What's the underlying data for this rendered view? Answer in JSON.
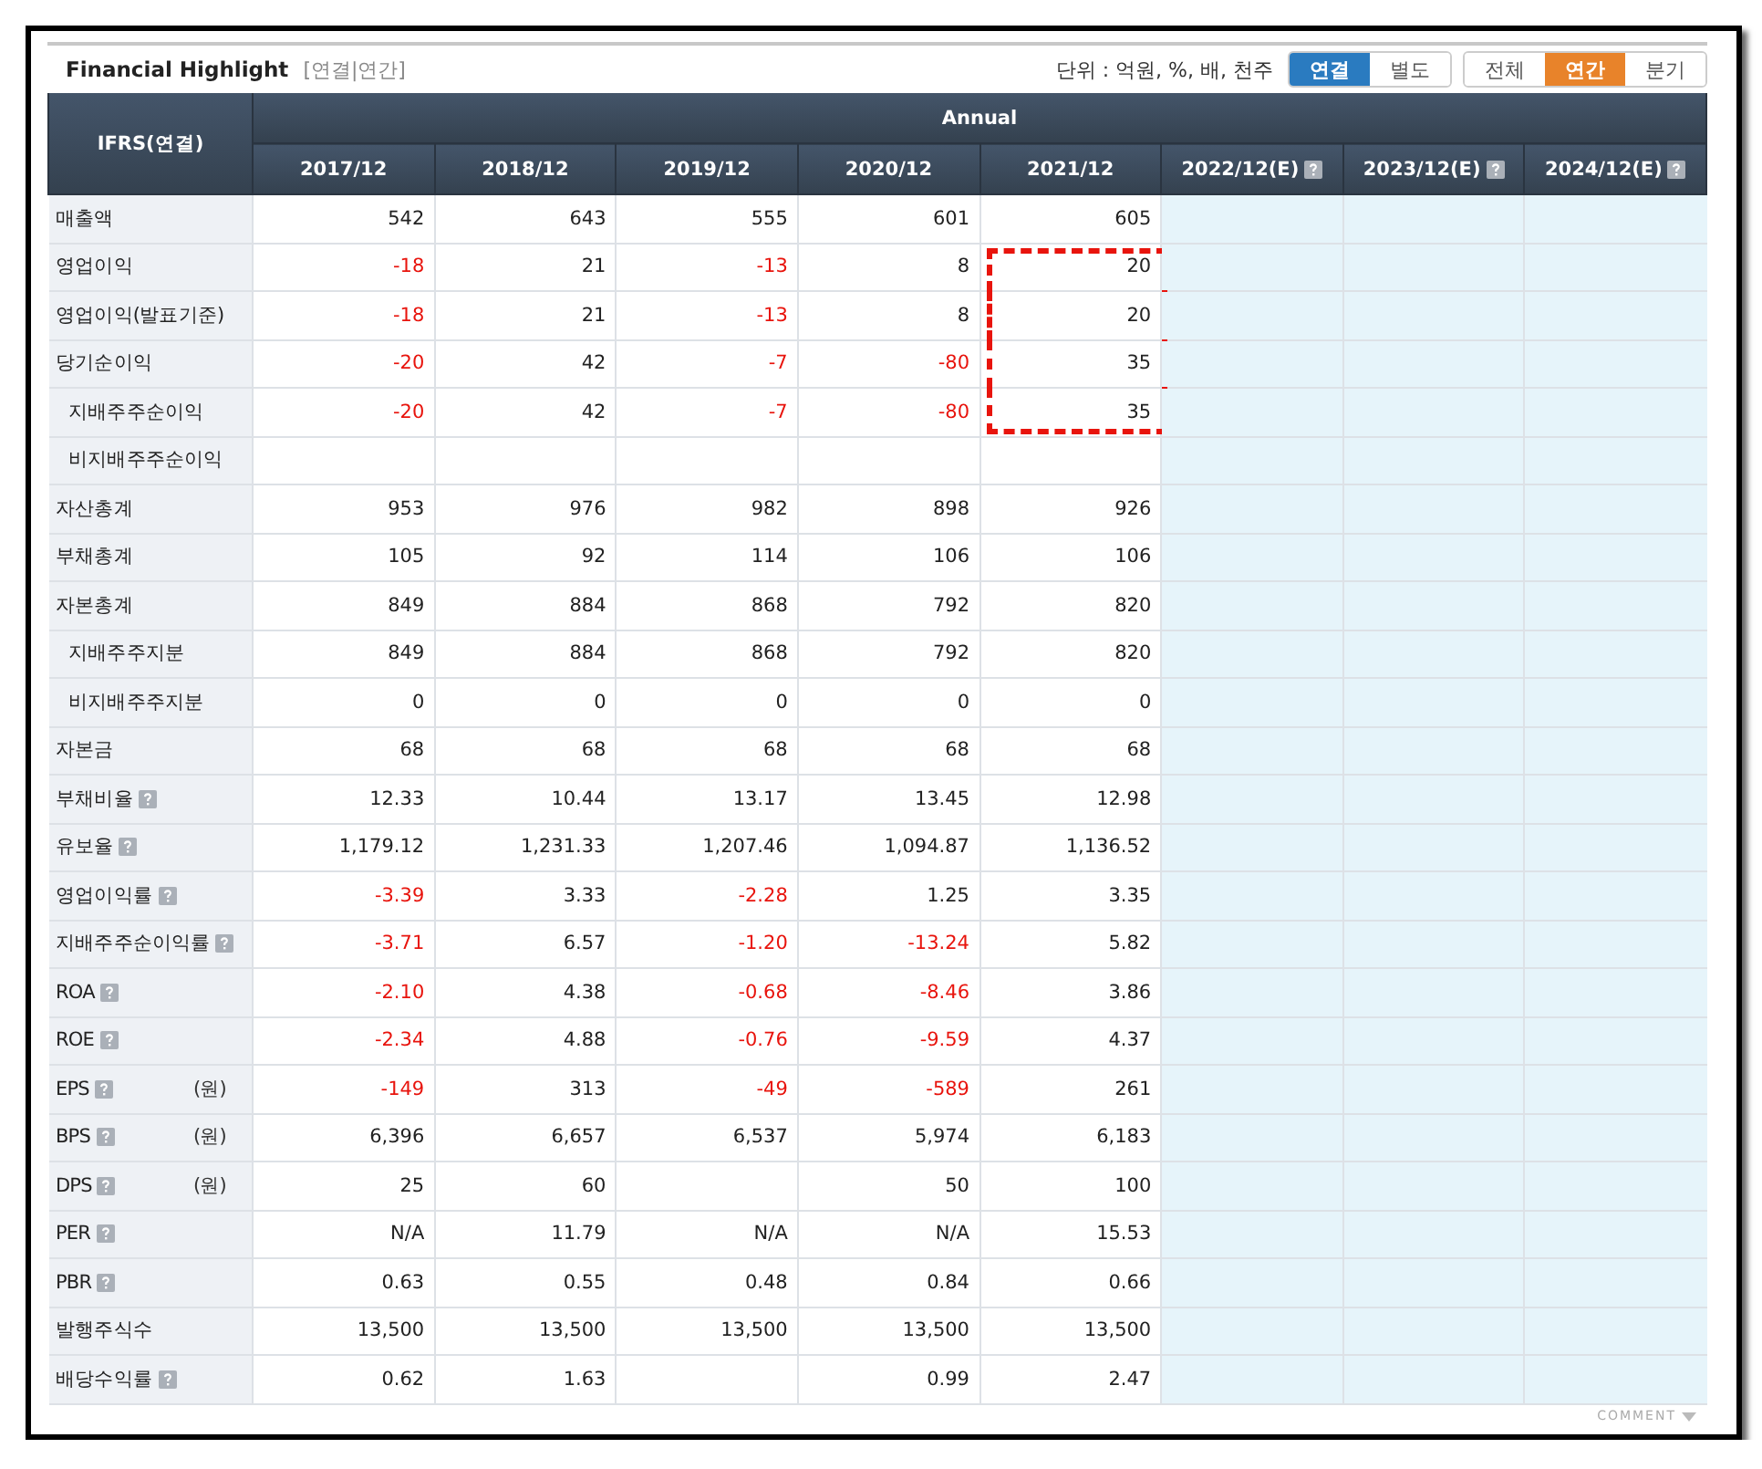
{
  "title": "Financial Highlight",
  "subtitle": "[연결|연간]",
  "unit": "단위 : 억원, %, 배, 천주",
  "toggle_groups": [
    {
      "kind": "consolidation",
      "options": [
        {
          "label": "연결",
          "selected": true
        },
        {
          "label": "별도",
          "selected": false
        }
      ]
    },
    {
      "kind": "period",
      "options": [
        {
          "label": "전체",
          "selected": false
        },
        {
          "label": "연간",
          "selected": true
        },
        {
          "label": "분기",
          "selected": false
        }
      ]
    }
  ],
  "table": {
    "corner": "IFRS(연결)",
    "group": "Annual",
    "columns": [
      {
        "label": "2017/12",
        "estimate": false
      },
      {
        "label": "2018/12",
        "estimate": false
      },
      {
        "label": "2019/12",
        "estimate": false
      },
      {
        "label": "2020/12",
        "estimate": false
      },
      {
        "label": "2021/12",
        "estimate": false
      },
      {
        "label": "2022/12(E)",
        "estimate": true
      },
      {
        "label": "2023/12(E)",
        "estimate": true
      },
      {
        "label": "2024/12(E)",
        "estimate": true
      }
    ],
    "rows": [
      {
        "label": "매출액",
        "indent": false,
        "help": false,
        "cells": [
          {
            "value": "542",
            "negative": false,
            "boxed": false
          },
          {
            "value": "643",
            "negative": false,
            "boxed": false
          },
          {
            "value": "555",
            "negative": false,
            "boxed": false
          },
          {
            "value": "601",
            "negative": false,
            "boxed": false
          },
          {
            "value": "605",
            "negative": false,
            "boxed": false
          }
        ]
      },
      {
        "label": "영업이익",
        "indent": false,
        "help": false,
        "cells": [
          {
            "value": "-18",
            "negative": true,
            "boxed": false
          },
          {
            "value": "21",
            "negative": false,
            "boxed": false
          },
          {
            "value": "-13",
            "negative": true,
            "boxed": false
          },
          {
            "value": "8",
            "negative": false,
            "boxed": false
          },
          {
            "value": "20",
            "negative": false,
            "boxed": true
          }
        ]
      },
      {
        "label": "영업이익(발표기준)",
        "indent": false,
        "help": false,
        "cells": [
          {
            "value": "-18",
            "negative": true,
            "boxed": false
          },
          {
            "value": "21",
            "negative": false,
            "boxed": false
          },
          {
            "value": "-13",
            "negative": true,
            "boxed": false
          },
          {
            "value": "8",
            "negative": false,
            "boxed": false
          },
          {
            "value": "20",
            "negative": false,
            "boxed": true
          }
        ]
      },
      {
        "label": "당기순이익",
        "indent": false,
        "help": false,
        "cells": [
          {
            "value": "-20",
            "negative": true,
            "boxed": false
          },
          {
            "value": "42",
            "negative": false,
            "boxed": false
          },
          {
            "value": "-7",
            "negative": true,
            "boxed": false
          },
          {
            "value": "-80",
            "negative": true,
            "boxed": false
          },
          {
            "value": "35",
            "negative": false,
            "boxed": true
          }
        ]
      },
      {
        "label": "지배주주순이익",
        "indent": true,
        "help": false,
        "cells": [
          {
            "value": "-20",
            "negative": true,
            "boxed": false
          },
          {
            "value": "42",
            "negative": false,
            "boxed": false
          },
          {
            "value": "-7",
            "negative": true,
            "boxed": false
          },
          {
            "value": "-80",
            "negative": true,
            "boxed": false
          },
          {
            "value": "35",
            "negative": false,
            "boxed": true
          }
        ]
      },
      {
        "label": "비지배주주순이익",
        "indent": true,
        "help": false,
        "cells": [
          {
            "negative": false,
            "boxed": false
          },
          {
            "negative": false,
            "boxed": false
          },
          {
            "negative": false,
            "boxed": false
          },
          {
            "negative": false,
            "boxed": false
          },
          {
            "negative": false,
            "boxed": false
          }
        ]
      },
      {
        "label": "자산총계",
        "indent": false,
        "help": false,
        "cells": [
          {
            "value": "953",
            "negative": false,
            "boxed": false
          },
          {
            "value": "976",
            "negative": false,
            "boxed": false
          },
          {
            "value": "982",
            "negative": false,
            "boxed": false
          },
          {
            "value": "898",
            "negative": false,
            "boxed": false
          },
          {
            "value": "926",
            "negative": false,
            "boxed": false
          }
        ]
      },
      {
        "label": "부채총계",
        "indent": false,
        "help": false,
        "cells": [
          {
            "value": "105",
            "negative": false,
            "boxed": false
          },
          {
            "value": "92",
            "negative": false,
            "boxed": false
          },
          {
            "value": "114",
            "negative": false,
            "boxed": false
          },
          {
            "value": "106",
            "negative": false,
            "boxed": false
          },
          {
            "value": "106",
            "negative": false,
            "boxed": false
          }
        ]
      },
      {
        "label": "자본총계",
        "indent": false,
        "help": false,
        "cells": [
          {
            "value": "849",
            "negative": false,
            "boxed": false
          },
          {
            "value": "884",
            "negative": false,
            "boxed": false
          },
          {
            "value": "868",
            "negative": false,
            "boxed": false
          },
          {
            "value": "792",
            "negative": false,
            "boxed": false
          },
          {
            "value": "820",
            "negative": false,
            "boxed": false
          }
        ]
      },
      {
        "label": "지배주주지분",
        "indent": true,
        "help": false,
        "cells": [
          {
            "value": "849",
            "negative": false,
            "boxed": false
          },
          {
            "value": "884",
            "negative": false,
            "boxed": false
          },
          {
            "value": "868",
            "negative": false,
            "boxed": false
          },
          {
            "value": "792",
            "negative": false,
            "boxed": false
          },
          {
            "value": "820",
            "negative": false,
            "boxed": false
          }
        ]
      },
      {
        "label": "비지배주주지분",
        "indent": true,
        "help": false,
        "cells": [
          {
            "value": "0",
            "negative": false,
            "boxed": false
          },
          {
            "value": "0",
            "negative": false,
            "boxed": false
          },
          {
            "value": "0",
            "negative": false,
            "boxed": false
          },
          {
            "value": "0",
            "negative": false,
            "boxed": false
          },
          {
            "value": "0",
            "negative": false,
            "boxed": false
          }
        ]
      },
      {
        "label": "자본금",
        "indent": false,
        "help": false,
        "cells": [
          {
            "value": "68",
            "negative": false,
            "boxed": false
          },
          {
            "value": "68",
            "negative": false,
            "boxed": false
          },
          {
            "value": "68",
            "negative": false,
            "boxed": false
          },
          {
            "value": "68",
            "negative": false,
            "boxed": false
          },
          {
            "value": "68",
            "negative": false,
            "boxed": false
          }
        ]
      },
      {
        "label": "부채비율",
        "indent": false,
        "help": true,
        "cells": [
          {
            "value": "12.33",
            "negative": false,
            "boxed": false
          },
          {
            "value": "10.44",
            "negative": false,
            "boxed": false
          },
          {
            "value": "13.17",
            "negative": false,
            "boxed": false
          },
          {
            "value": "13.45",
            "negative": false,
            "boxed": false
          },
          {
            "value": "12.98",
            "negative": false,
            "boxed": false
          }
        ]
      },
      {
        "label": "유보율",
        "indent": false,
        "help": true,
        "cells": [
          {
            "value": "1,179.12",
            "negative": false,
            "boxed": false
          },
          {
            "value": "1,231.33",
            "negative": false,
            "boxed": false
          },
          {
            "value": "1,207.46",
            "negative": false,
            "boxed": false
          },
          {
            "value": "1,094.87",
            "negative": false,
            "boxed": false
          },
          {
            "value": "1,136.52",
            "negative": false,
            "boxed": false
          }
        ]
      },
      {
        "label": "영업이익률",
        "indent": false,
        "help": true,
        "cells": [
          {
            "value": "-3.39",
            "negative": true,
            "boxed": false
          },
          {
            "value": "3.33",
            "negative": false,
            "boxed": false
          },
          {
            "value": "-2.28",
            "negative": true,
            "boxed": false
          },
          {
            "value": "1.25",
            "negative": false,
            "boxed": false
          },
          {
            "value": "3.35",
            "negative": false,
            "boxed": false
          }
        ]
      },
      {
        "label": "지배주주순이익률",
        "indent": false,
        "help": true,
        "cells": [
          {
            "value": "-3.71",
            "negative": true,
            "boxed": false
          },
          {
            "value": "6.57",
            "negative": false,
            "boxed": false
          },
          {
            "value": "-1.20",
            "negative": true,
            "boxed": false
          },
          {
            "value": "-13.24",
            "negative": true,
            "boxed": false
          },
          {
            "value": "5.82",
            "negative": false,
            "boxed": false
          }
        ]
      },
      {
        "label": "ROA",
        "indent": false,
        "help": true,
        "cells": [
          {
            "value": "-2.10",
            "negative": true,
            "boxed": false
          },
          {
            "value": "4.38",
            "negative": false,
            "boxed": false
          },
          {
            "value": "-0.68",
            "negative": true,
            "boxed": false
          },
          {
            "value": "-8.46",
            "negative": true,
            "boxed": false
          },
          {
            "value": "3.86",
            "negative": false,
            "boxed": false
          }
        ]
      },
      {
        "label": "ROE",
        "indent": false,
        "help": true,
        "cells": [
          {
            "value": "-2.34",
            "negative": true,
            "boxed": false
          },
          {
            "value": "4.88",
            "negative": false,
            "boxed": false
          },
          {
            "value": "-0.76",
            "negative": true,
            "boxed": false
          },
          {
            "value": "-9.59",
            "negative": true,
            "boxed": false
          },
          {
            "value": "4.37",
            "negative": false,
            "boxed": false
          }
        ]
      },
      {
        "label": "EPS",
        "indent": false,
        "help": true,
        "unit": "(원)",
        "cells": [
          {
            "value": "-149",
            "negative": true,
            "boxed": false
          },
          {
            "value": "313",
            "negative": false,
            "boxed": false
          },
          {
            "value": "-49",
            "negative": true,
            "boxed": false
          },
          {
            "value": "-589",
            "negative": true,
            "boxed": false
          },
          {
            "value": "261",
            "negative": false,
            "boxed": false
          }
        ]
      },
      {
        "label": "BPS",
        "indent": false,
        "help": true,
        "unit": "(원)",
        "cells": [
          {
            "value": "6,396",
            "negative": false,
            "boxed": false
          },
          {
            "value": "6,657",
            "negative": false,
            "boxed": false
          },
          {
            "value": "6,537",
            "negative": false,
            "boxed": false
          },
          {
            "value": "5,974",
            "negative": false,
            "boxed": false
          },
          {
            "value": "6,183",
            "negative": false,
            "boxed": false
          }
        ]
      },
      {
        "label": "DPS",
        "indent": false,
        "help": true,
        "unit": "(원)",
        "cells": [
          {
            "value": "25",
            "negative": false,
            "boxed": false
          },
          {
            "value": "60",
            "negative": false,
            "boxed": false
          },
          {
            "negative": false,
            "boxed": false
          },
          {
            "value": "50",
            "negative": false,
            "boxed": false
          },
          {
            "value": "100",
            "negative": false,
            "boxed": false
          }
        ]
      },
      {
        "label": "PER",
        "indent": false,
        "help": true,
        "cells": [
          {
            "value": "N/A",
            "negative": false,
            "boxed": false
          },
          {
            "value": "11.79",
            "negative": false,
            "boxed": false
          },
          {
            "value": "N/A",
            "negative": false,
            "boxed": false
          },
          {
            "value": "N/A",
            "negative": false,
            "boxed": false
          },
          {
            "value": "15.53",
            "negative": false,
            "boxed": false
          }
        ]
      },
      {
        "label": "PBR",
        "indent": false,
        "help": true,
        "cells": [
          {
            "value": "0.63",
            "negative": false,
            "boxed": false
          },
          {
            "value": "0.55",
            "negative": false,
            "boxed": false
          },
          {
            "value": "0.48",
            "negative": false,
            "boxed": false
          },
          {
            "value": "0.84",
            "negative": false,
            "boxed": false
          },
          {
            "value": "0.66",
            "negative": false,
            "boxed": false
          }
        ]
      },
      {
        "label": "발행주식수",
        "indent": false,
        "help": false,
        "cells": [
          {
            "value": "13,500",
            "negative": false,
            "boxed": false
          },
          {
            "value": "13,500",
            "negative": false,
            "boxed": false
          },
          {
            "value": "13,500",
            "negative": false,
            "boxed": false
          },
          {
            "value": "13,500",
            "negative": false,
            "boxed": false
          },
          {
            "value": "13,500",
            "negative": false,
            "boxed": false
          }
        ]
      },
      {
        "label": "배당수익률",
        "indent": false,
        "help": true,
        "cells": [
          {
            "value": "0.62",
            "negative": false,
            "boxed": false
          },
          {
            "value": "1.63",
            "negative": false,
            "boxed": false
          },
          {
            "negative": false,
            "boxed": false
          },
          {
            "value": "0.99",
            "negative": false,
            "boxed": false
          },
          {
            "value": "2.47",
            "negative": false,
            "boxed": false
          }
        ]
      }
    ]
  },
  "comment": "COMMENT"
}
